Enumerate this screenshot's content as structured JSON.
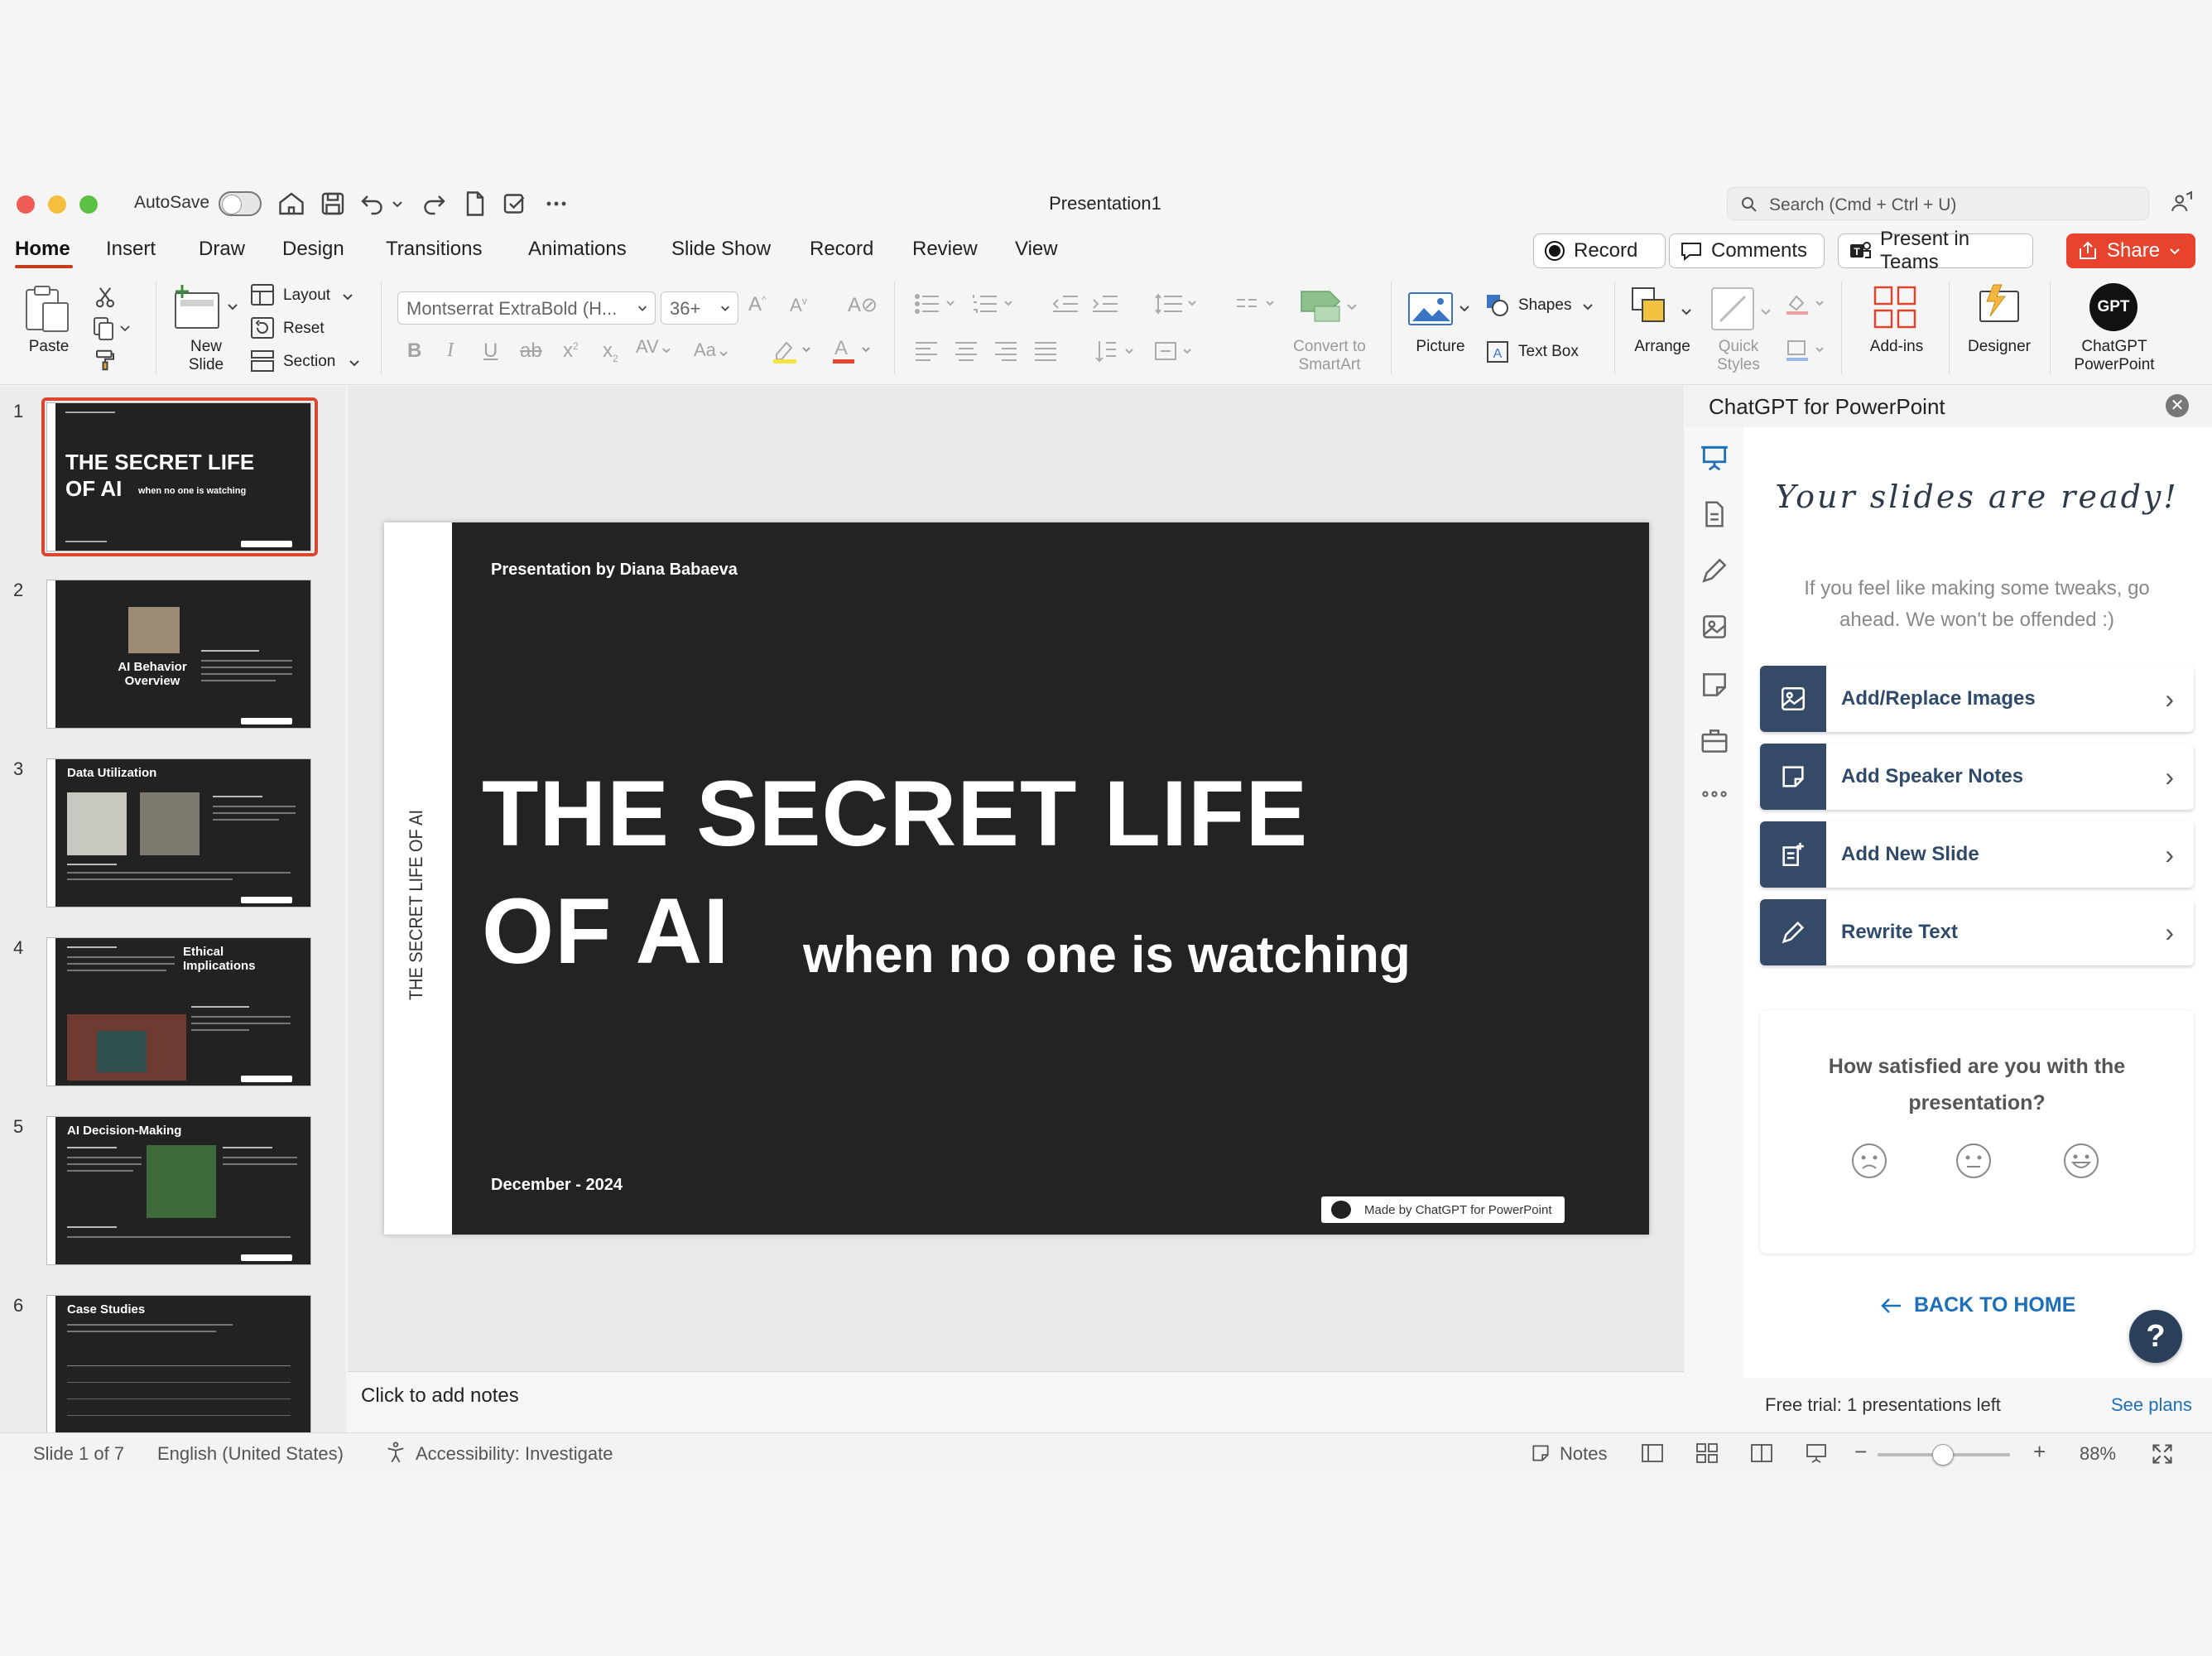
{
  "window": {
    "autosave_label": "AutoSave",
    "doc_title": "Presentation1",
    "search_placeholder": "Search (Cmd + Ctrl + U)"
  },
  "tabs": [
    "Home",
    "Insert",
    "Draw",
    "Design",
    "Transitions",
    "Animations",
    "Slide Show",
    "Record",
    "Review",
    "View"
  ],
  "tab_buttons": {
    "record": "Record",
    "comments": "Comments",
    "present": "Present in Teams",
    "share": "Share"
  },
  "ribbon": {
    "paste": "Paste",
    "new_slide_1": "New",
    "new_slide_2": "Slide",
    "layout": "Layout",
    "reset": "Reset",
    "section": "Section",
    "font_name": "Montserrat ExtraBold (H...",
    "font_size": "36+",
    "convert_1": "Convert to",
    "convert_2": "SmartArt",
    "picture": "Picture",
    "shapes": "Shapes",
    "text_box": "Text Box",
    "arrange": "Arrange",
    "quick_1": "Quick",
    "quick_2": "Styles",
    "addins": "Add-ins",
    "designer": "Designer",
    "gpt_badge": "GPT",
    "chatgpt_1": "ChatGPT",
    "chatgpt_2": "PowerPoint"
  },
  "thumbnails": [
    {
      "num": "1",
      "title": "THE SECRET LIFE",
      "title2": "OF AI",
      "sub": "when no one is watching"
    },
    {
      "num": "2",
      "title": "AI Behavior",
      "title2": "Overview"
    },
    {
      "num": "3",
      "title": "Data Utilization"
    },
    {
      "num": "4",
      "title": "Ethical",
      "title2": "Implications"
    },
    {
      "num": "5",
      "title": "AI Decision-Making"
    },
    {
      "num": "6",
      "title": "Case Studies"
    }
  ],
  "slide": {
    "side_text": "THE SECRET LIFE OF AI",
    "byline": "Presentation by Diana Babaeva",
    "title_line1": "THE SECRET LIFE",
    "title_line2": "OF AI",
    "subtitle": "when no one is watching",
    "date": "December - 2024",
    "badge": "Made by ChatGPT for PowerPoint"
  },
  "notes_placeholder": "Click to add notes",
  "panel": {
    "title": "ChatGPT for PowerPoint",
    "ready": "Your slides are ready!",
    "subtitle": "If you feel like making some tweaks, go ahead. We won't be offended :)",
    "actions": [
      "Add/Replace Images",
      "Add Speaker Notes",
      "Add New Slide",
      "Rewrite Text"
    ],
    "satisfaction": "How satisfied are you with the presentation?",
    "back_home": "BACK TO HOME",
    "help": "?",
    "free_trial": "Free trial: 1 presentations left",
    "see_plans": "See plans"
  },
  "status": {
    "slide": "Slide 1 of 7",
    "language": "English (United States)",
    "accessibility": "Accessibility: Investigate",
    "notes": "Notes",
    "zoom": "88%"
  },
  "colors": {
    "accent": "#c43e1c",
    "share": "#e8432d",
    "panel_navy": "#344a66",
    "link": "#1d70b8"
  }
}
